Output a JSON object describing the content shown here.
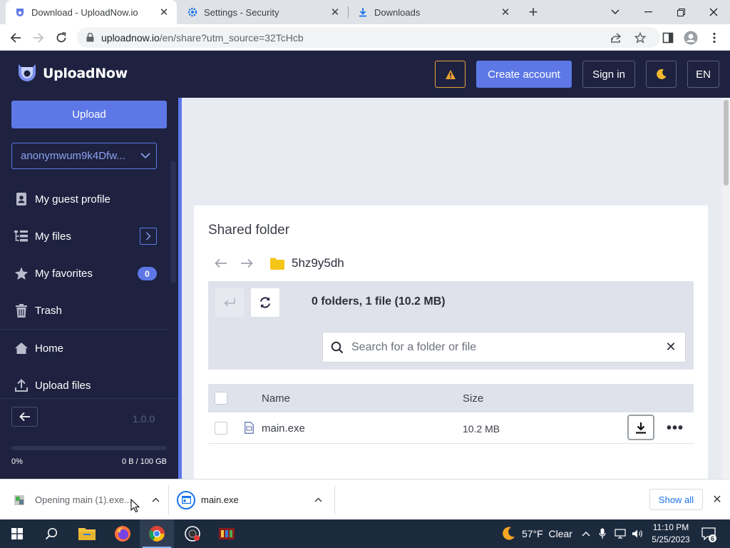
{
  "browser": {
    "tabs": [
      {
        "label": "Download - UploadNow.io",
        "active": true,
        "icon": "uploadnow-favicon"
      },
      {
        "label": "Settings - Security",
        "active": false,
        "icon": "gear-icon"
      },
      {
        "label": "Downloads",
        "active": false,
        "icon": "download-icon"
      }
    ],
    "url_host": "uploadnow.io",
    "url_path": "/en/share?utm_source=32TcHcb"
  },
  "header": {
    "brand": "UploadNow",
    "create_account": "Create account",
    "sign_in": "Sign in",
    "language": "EN"
  },
  "sidebar": {
    "upload_label": "Upload",
    "account": "anonymwum9k4Dfw...",
    "items": [
      {
        "label": "My guest profile",
        "icon": "profile-icon"
      },
      {
        "label": "My files",
        "icon": "files-tree-icon"
      },
      {
        "label": "My favorites",
        "icon": "star-icon",
        "badge": "0"
      },
      {
        "label": "Trash",
        "icon": "trash-icon"
      },
      {
        "label": "Home",
        "icon": "home-icon"
      },
      {
        "label": "Upload files",
        "icon": "upload-icon"
      }
    ],
    "version": "1.0.0",
    "usage_percent": "0%",
    "usage_fraction": 0,
    "usage_amount": "0 B / 100 GB"
  },
  "main": {
    "title": "Shared folder",
    "folder_name": "5hz9y5dh",
    "summary": "0 folders, 1 file (10.2 MB)",
    "search_placeholder": "Search for a folder or file",
    "columns": {
      "name": "Name",
      "size": "Size"
    },
    "files": [
      {
        "name": "main.exe",
        "size": "10.2 MB"
      }
    ]
  },
  "downloads_bar": {
    "items": [
      {
        "label": "Opening main (1).exe..."
      },
      {
        "label": "main.exe"
      }
    ],
    "show_all": "Show all"
  },
  "taskbar": {
    "weather": "57°F  Clear",
    "time": "11:10 PM",
    "date": "5/25/2023",
    "notifications": "6"
  },
  "colors": {
    "brand_navy": "#1e2240",
    "accent_blue": "#5d78e6",
    "warning": "#e8a03c"
  }
}
